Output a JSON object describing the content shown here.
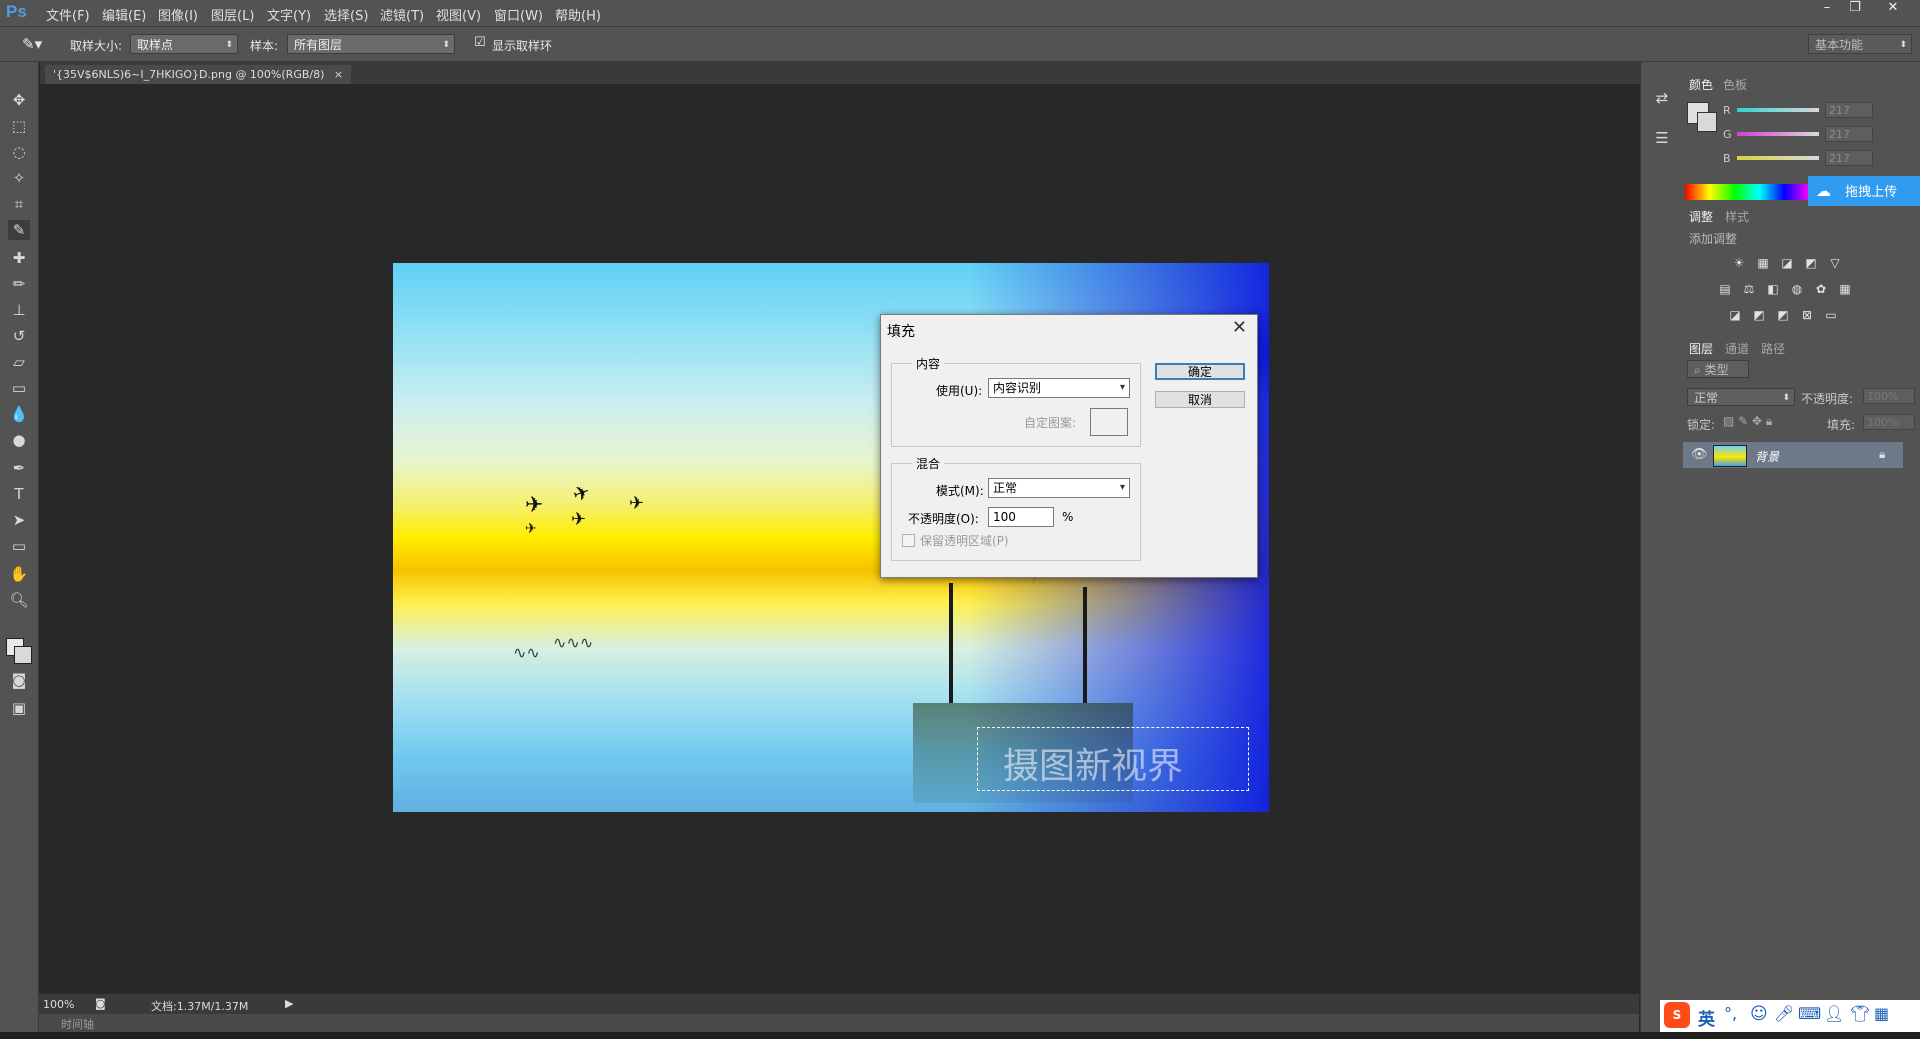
{
  "app": {
    "logo": "Ps"
  },
  "menu": [
    "文件(F)",
    "编辑(E)",
    "图像(I)",
    "图层(L)",
    "文字(Y)",
    "选择(S)",
    "滤镜(T)",
    "视图(V)",
    "窗口(W)",
    "帮助(H)"
  ],
  "window_controls": {
    "minimize": "–",
    "restore": "❐",
    "close": "✕"
  },
  "options": {
    "sample_size_label": "取样大小:",
    "sample_size_value": "取样点",
    "sample_label": "样本:",
    "sample_value": "所有图层",
    "show_ring_label": "显示取样环",
    "workspace": "基本功能"
  },
  "document_tab": {
    "title": "'{35V$6NLS)6~I_7HKIGO}D.png @ 100%(RGB/8)",
    "close": "×"
  },
  "image_overlay": {
    "watermark": "摄图新视界"
  },
  "dialog": {
    "title": "填充",
    "close": "✕",
    "content_group": "内容",
    "use_label": "使用(U):",
    "use_value": "内容识别",
    "custom_pattern_label": "自定图案:",
    "blend_group": "混合",
    "mode_label": "模式(M):",
    "mode_value": "正常",
    "opacity_label": "不透明度(O):",
    "opacity_value": "100",
    "opacity_unit": "%",
    "preserve_label": "保留透明区域(P)",
    "ok": "确定",
    "cancel": "取消"
  },
  "color_panel": {
    "tabs": [
      "颜色",
      "色板"
    ],
    "channels": [
      {
        "name": "R",
        "value": "217",
        "color": "#2fd3d3"
      },
      {
        "name": "G",
        "value": "217",
        "color": "#d53fd5"
      },
      {
        "name": "B",
        "value": "217",
        "color": "#d5d53f"
      }
    ]
  },
  "upload_badge": "拖拽上传",
  "adjust_panel": {
    "tabs": [
      "调整",
      "样式"
    ],
    "subtitle": "添加调整"
  },
  "layers_panel": {
    "tabs": [
      "图层",
      "通道",
      "路径"
    ],
    "filter_label": "类型",
    "blend_mode": "正常",
    "opacity_label": "不透明度:",
    "opacity_value": "100%",
    "lock_label": "锁定:",
    "fill_label": "填充:",
    "fill_value": "100%",
    "layer_name": "背景"
  },
  "status": {
    "zoom": "100%",
    "doc": "文档:1.37M/1.37M"
  },
  "timeline": {
    "label": "时间轴"
  },
  "ime": {
    "lang": "英"
  }
}
